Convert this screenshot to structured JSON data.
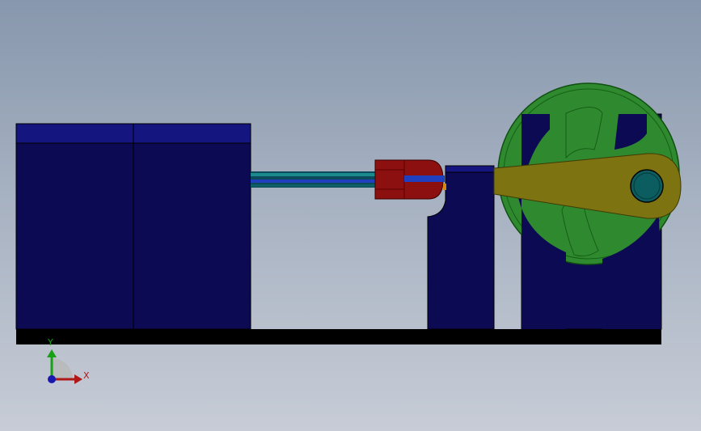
{
  "viewport": {
    "background_top": "#8797ad",
    "background_bottom": "#c7ccd6"
  },
  "model": {
    "components": [
      "base-plate",
      "motor-housing",
      "piston-rod",
      "crosshead",
      "guide-block",
      "flywheel-support",
      "flywheel",
      "connecting-rod",
      "crank-pin"
    ],
    "colors": {
      "body": "#0b0a52",
      "base": "#000000",
      "crosshead": "#8d1010",
      "flywheel": "#2f8a2f",
      "connecting_rod": "#7d7310",
      "crank_pin": "#0b5d5f"
    }
  },
  "triad": {
    "x_label": "X",
    "y_label": "Y",
    "x_color": "#b01818",
    "y_color": "#18a018",
    "z_color": "#1818b0"
  }
}
